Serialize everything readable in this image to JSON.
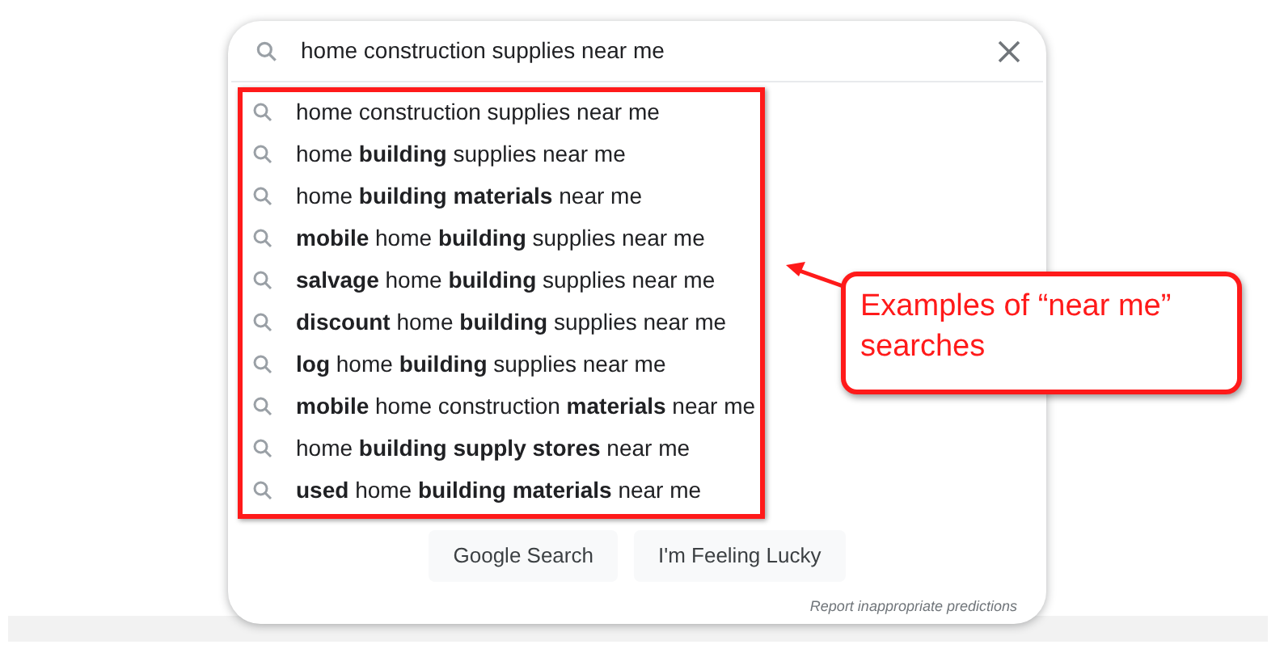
{
  "search": {
    "value": "home construction supplies near me"
  },
  "suggestions": [
    "home construction supplies near me",
    "home **building** supplies near me",
    "home **building materials** near me",
    "**mobile** home **building** supplies near me",
    "**salvage** home **building** supplies near me",
    "**discount** home **building** supplies near me",
    "**log** home **building** supplies near me",
    "**mobile** home construction **materials** near me",
    "home **building supply stores** near me",
    "**used** home **building materials** near me"
  ],
  "buttons": [
    "Google Search",
    "I'm Feeling Lucky"
  ],
  "report_link": "Report inappropriate predictions",
  "annotation": {
    "callout": "Examples of “near me” searches"
  }
}
